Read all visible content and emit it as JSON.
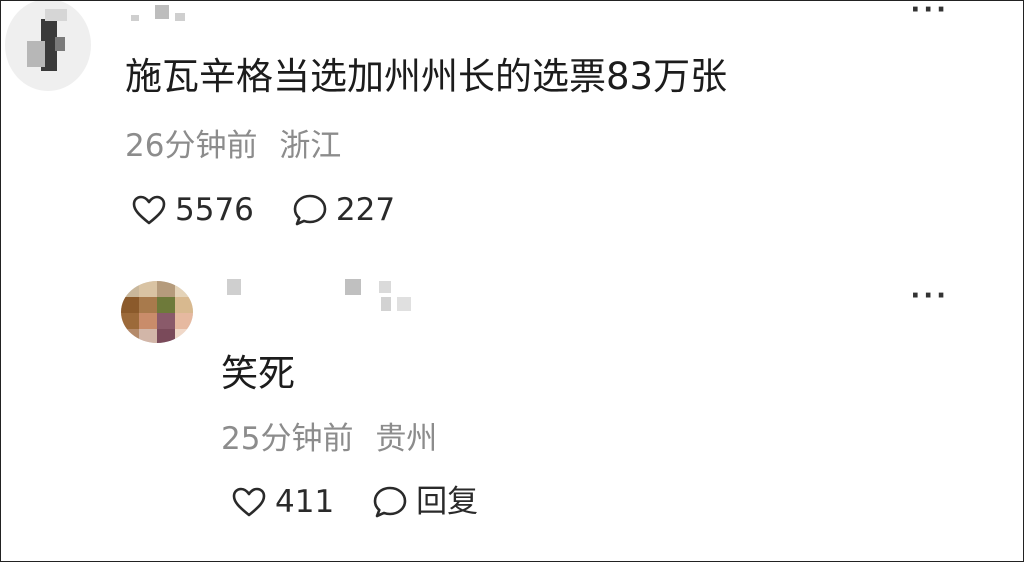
{
  "comments": [
    {
      "text": "施瓦辛格当选加州州长的选票83万张",
      "time": "26分钟前",
      "location": "浙江",
      "likes": "5576",
      "replies": "227",
      "more": "···"
    }
  ],
  "replies": [
    {
      "text": "笑死",
      "time": "25分钟前",
      "location": "贵州",
      "likes": "411",
      "reply_label": "回复",
      "more": "···"
    }
  ],
  "icons": {
    "like": "heart-outline-icon",
    "reply": "speech-bubble-icon",
    "more": "more-dots-icon"
  },
  "colors": {
    "meta_text": "#8c8c8c",
    "body_text": "#1c1c1c"
  }
}
